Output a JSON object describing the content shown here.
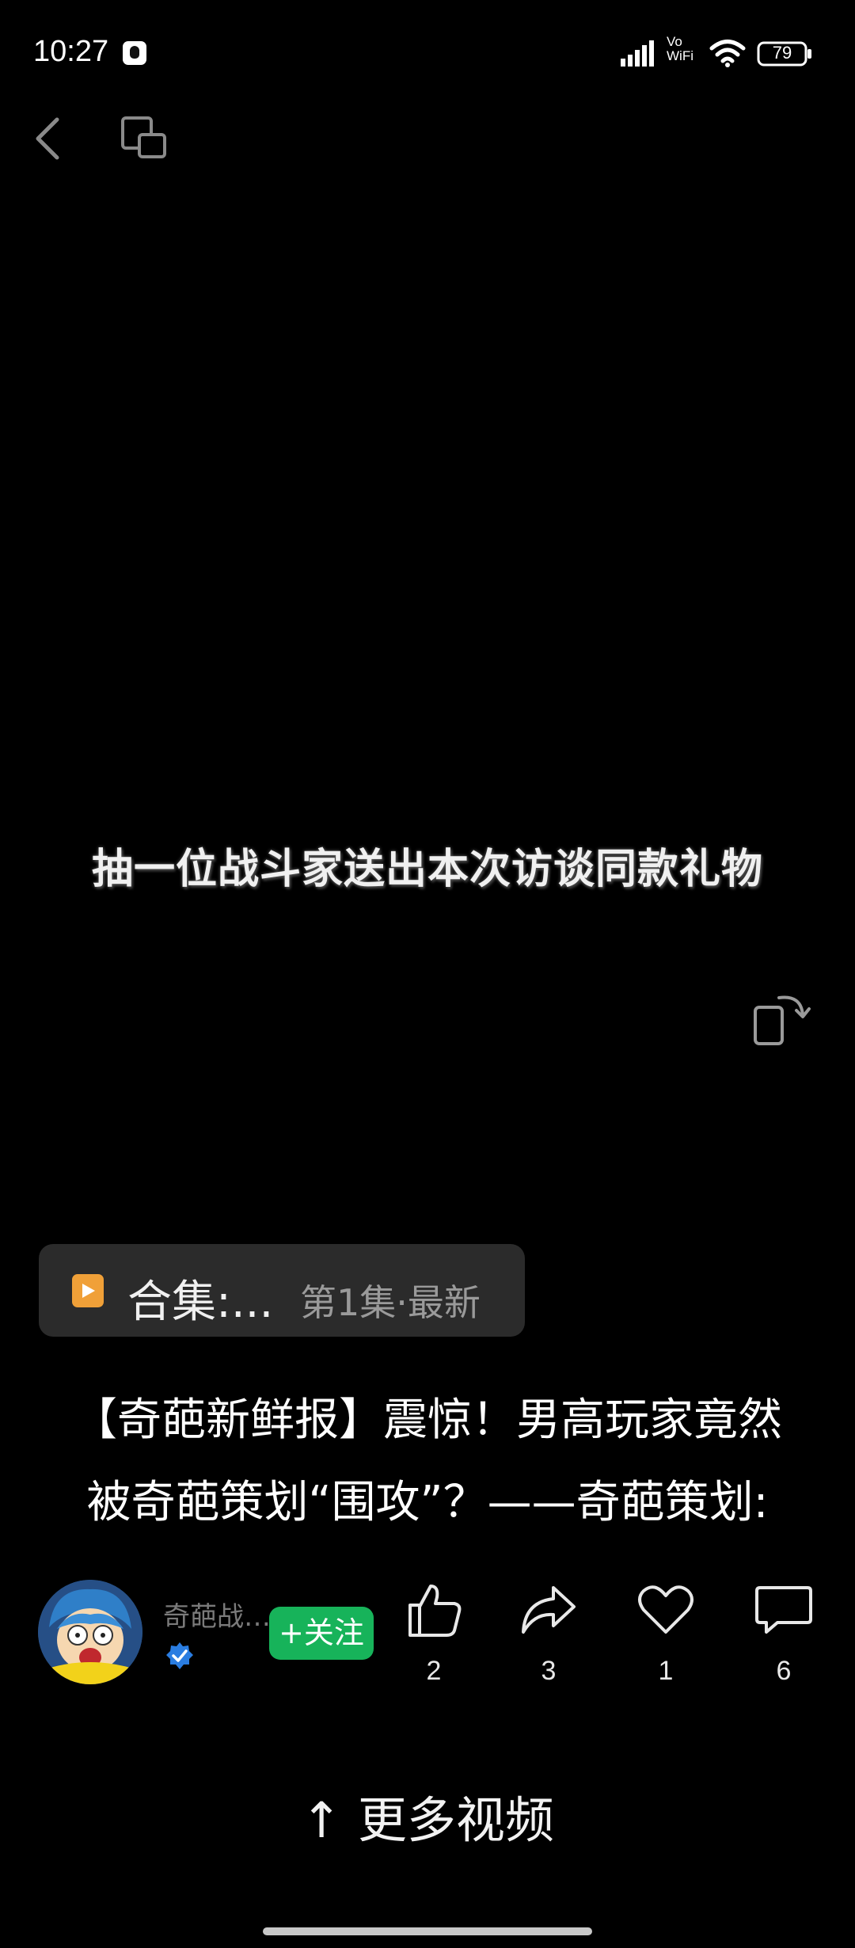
{
  "status_bar": {
    "time": "10:27",
    "vowifi_top": "Vo",
    "vowifi_bottom": "WiFi",
    "battery": "79"
  },
  "nav": {
    "back_icon": "chevron-left-icon",
    "screen_icon": "picture-in-picture-icon"
  },
  "video": {
    "subtitle": "抽一位战斗家送出本次访谈同款礼物",
    "rotate_icon": "rotate-screen-icon"
  },
  "collection": {
    "title": "合集:...",
    "meta": "第1集·最新",
    "accent_color": "#f0a038"
  },
  "video_title": {
    "line1": "【奇葩新鲜报】震惊！男高玩家竟然",
    "line2": "被奇葩策划“围攻”？——奇葩策划:"
  },
  "author": {
    "name": "奇葩战…",
    "follow_label": "+关注",
    "follow_color": "#17b35a",
    "verified_color": "#2a7de1"
  },
  "actions": {
    "like": {
      "icon": "thumbs-up-icon",
      "count": "2"
    },
    "share": {
      "icon": "share-arrow-icon",
      "count": "3"
    },
    "favorite": {
      "icon": "heart-icon",
      "count": "1"
    },
    "comment": {
      "icon": "comment-bubble-icon",
      "count": "6"
    }
  },
  "more_videos_label": "↑ 更多视频"
}
